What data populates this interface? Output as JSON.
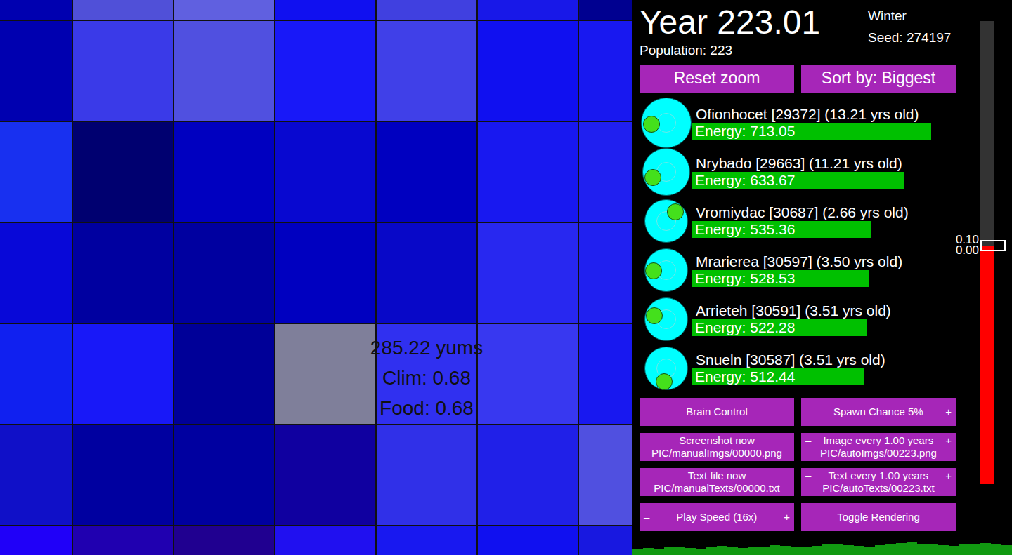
{
  "map": {
    "tiles": [
      [
        {
          "color": "#0000b0",
          "selected": false
        },
        {
          "color": "#5050d8",
          "selected": false
        },
        {
          "color": "#6060e0",
          "selected": false
        },
        {
          "color": "#1010f0",
          "selected": false
        },
        {
          "color": "#4040e0",
          "selected": false
        },
        {
          "color": "#1818e8",
          "selected": false
        },
        {
          "color": "#000090",
          "selected": false
        }
      ],
      [
        {
          "color": "#0000b0",
          "selected": false
        },
        {
          "color": "#3a3ae8",
          "selected": false
        },
        {
          "color": "#5050e0",
          "selected": false
        },
        {
          "color": "#1818f8",
          "selected": false
        },
        {
          "color": "#4040e8",
          "selected": false
        },
        {
          "color": "#1010f0",
          "selected": false
        },
        {
          "color": "#1818f0",
          "selected": false
        }
      ],
      [
        {
          "color": "#1830f0",
          "selected": false
        },
        {
          "color": "#000070",
          "selected": false
        },
        {
          "color": "#0000c0",
          "selected": false
        },
        {
          "color": "#0808d0",
          "selected": false
        },
        {
          "color": "#0000c0",
          "selected": false
        },
        {
          "color": "#1818f0",
          "selected": false
        },
        {
          "color": "#2020f0",
          "selected": false
        }
      ],
      [
        {
          "color": "#0808d8",
          "selected": false
        },
        {
          "color": "#0000a0",
          "selected": false
        },
        {
          "color": "#0000a0",
          "selected": false
        },
        {
          "color": "#0000c0",
          "selected": false
        },
        {
          "color": "#0808c8",
          "selected": false
        },
        {
          "color": "#2828f0",
          "selected": false
        },
        {
          "color": "#2020f0",
          "selected": false
        }
      ],
      [
        {
          "color": "#1020f0",
          "selected": false
        },
        {
          "color": "#1818f8",
          "selected": false
        },
        {
          "color": "#000098",
          "selected": false
        },
        {
          "color": "#7f7f9a",
          "selected": true
        },
        {
          "color": "#3030f0",
          "selected": false
        },
        {
          "color": "#3838f0",
          "selected": false
        },
        {
          "color": "#1818f0",
          "selected": false
        }
      ],
      [
        {
          "color": "#1010c8",
          "selected": false
        },
        {
          "color": "#0000a0",
          "selected": false
        },
        {
          "color": "#0000a0",
          "selected": false
        },
        {
          "color": "#1000a0",
          "selected": false
        },
        {
          "color": "#3030e8",
          "selected": false
        },
        {
          "color": "#2020e8",
          "selected": false
        },
        {
          "color": "#5050e0",
          "selected": false
        }
      ],
      [
        {
          "color": "#2000f8",
          "selected": false
        },
        {
          "color": "#2000b0",
          "selected": false
        },
        {
          "color": "#200090",
          "selected": false
        },
        {
          "color": "#2010f0",
          "selected": false
        },
        {
          "color": "#1818f0",
          "selected": false
        },
        {
          "color": "#1010f0",
          "selected": false
        },
        {
          "color": "#1818e0",
          "selected": false
        }
      ]
    ],
    "tile_info": [
      "285.22 yums",
      "Clim: 0.68",
      "Food: 0.68"
    ]
  },
  "header": {
    "year": "Year 223.01",
    "season": "Winter",
    "seed": "Seed: 274197",
    "population": "Population: 223"
  },
  "top_buttons": [
    "Reset zoom",
    "Sort by: Biggest"
  ],
  "creatures": [
    {
      "name": "Ofionhocet [29372] (13.21 yrs old)",
      "energy": "Energy: 713.05",
      "level": 0.85,
      "size": 72,
      "mouth_angle": 178
    },
    {
      "name": "Nrybado [29663] (11.21 yrs old)",
      "energy": "Energy: 633.67",
      "level": 0.755,
      "size": 68,
      "mouth_angle": 160
    },
    {
      "name": "Vromiydac [30687] (2.66 yrs old)",
      "energy": "Energy: 535.36",
      "level": 0.638,
      "size": 62,
      "mouth_angle": 313
    },
    {
      "name": "Mrarierea [30597] (3.50 yrs old)",
      "energy": "Energy: 528.53",
      "level": 0.63,
      "size": 62,
      "mouth_angle": 180
    },
    {
      "name": "Arrieteh [30591] (3.51 yrs old)",
      "energy": "Energy: 522.28",
      "level": 0.623,
      "size": 62,
      "mouth_angle": 200
    },
    {
      "name": "Snueln [30587] (3.51 yrs old)",
      "energy": "Energy: 512.44",
      "level": 0.61,
      "size": 62,
      "mouth_angle": 100
    }
  ],
  "controls": [
    {
      "kind": "plain",
      "label": "Brain Control",
      "sub": ""
    },
    {
      "kind": "stepper",
      "minus": "–",
      "label": "Spawn Chance 5%",
      "plus": "+",
      "sub": ""
    },
    {
      "kind": "plain",
      "label": "Screenshot now",
      "sub": "PIC/manualImgs/00000.png"
    },
    {
      "kind": "stepper",
      "minus": "–",
      "label": "Image every 1.00 years",
      "plus": "+",
      "sub": "PIC/autoImgs/00223.png"
    },
    {
      "kind": "plain",
      "label": "Text file now",
      "sub": "PIC/manualTexts/00000.txt"
    },
    {
      "kind": "stepper",
      "minus": "–",
      "label": "Text every 1.00 years",
      "plus": "+",
      "sub": "PIC/autoTexts/00223.txt"
    },
    {
      "kind": "stepper",
      "minus": "–",
      "label": "Play Speed (16x)",
      "plus": "+",
      "sub": ""
    },
    {
      "kind": "plain",
      "label": "Toggle Rendering",
      "sub": ""
    }
  ],
  "slider": {
    "labels": [
      "0.10",
      "0.00"
    ],
    "level": 0.515
  },
  "history": {
    "values": [
      8,
      10,
      9,
      11,
      12,
      10,
      9,
      11,
      13,
      12,
      10,
      11,
      12,
      14,
      13,
      12,
      11,
      13,
      15,
      16,
      14,
      13,
      12,
      14,
      15,
      17,
      18,
      16,
      15,
      14,
      13,
      15,
      16,
      17,
      15,
      14
    ]
  }
}
